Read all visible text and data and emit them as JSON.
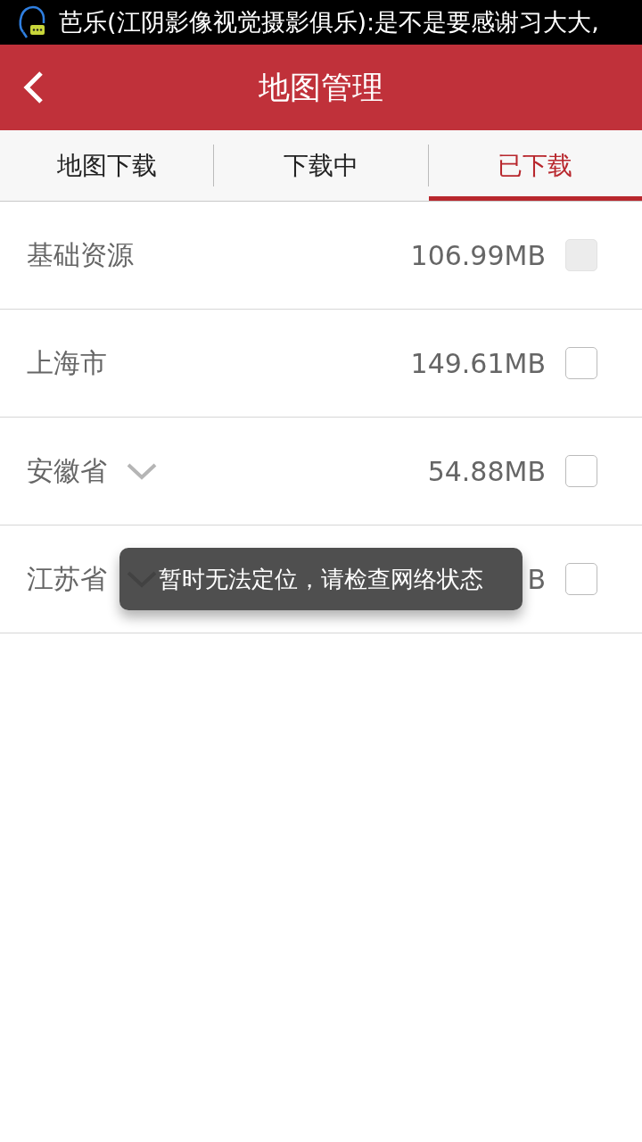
{
  "status_bar": {
    "notification": "芭乐(江阴影像视觉摄影俱乐):是不是要感谢习大大,"
  },
  "header": {
    "title": "地图管理"
  },
  "tabs": [
    {
      "label": "地图下载",
      "selected": false
    },
    {
      "label": "下载中",
      "selected": false
    },
    {
      "label": "已下载",
      "selected": true
    }
  ],
  "rows": [
    {
      "name": "基础资源",
      "size": "106.99MB",
      "expandable": false,
      "disabled": true,
      "checked": false
    },
    {
      "name": "上海市",
      "size": "149.61MB",
      "expandable": false,
      "disabled": false,
      "checked": false
    },
    {
      "name": "安徽省",
      "size": "54.88MB",
      "expandable": true,
      "disabled": false,
      "checked": false
    },
    {
      "name": "江苏省",
      "size": "B",
      "expandable": true,
      "disabled": false,
      "checked": false
    }
  ],
  "toast": {
    "text": "暂时无法定位，请检查网络状态"
  }
}
